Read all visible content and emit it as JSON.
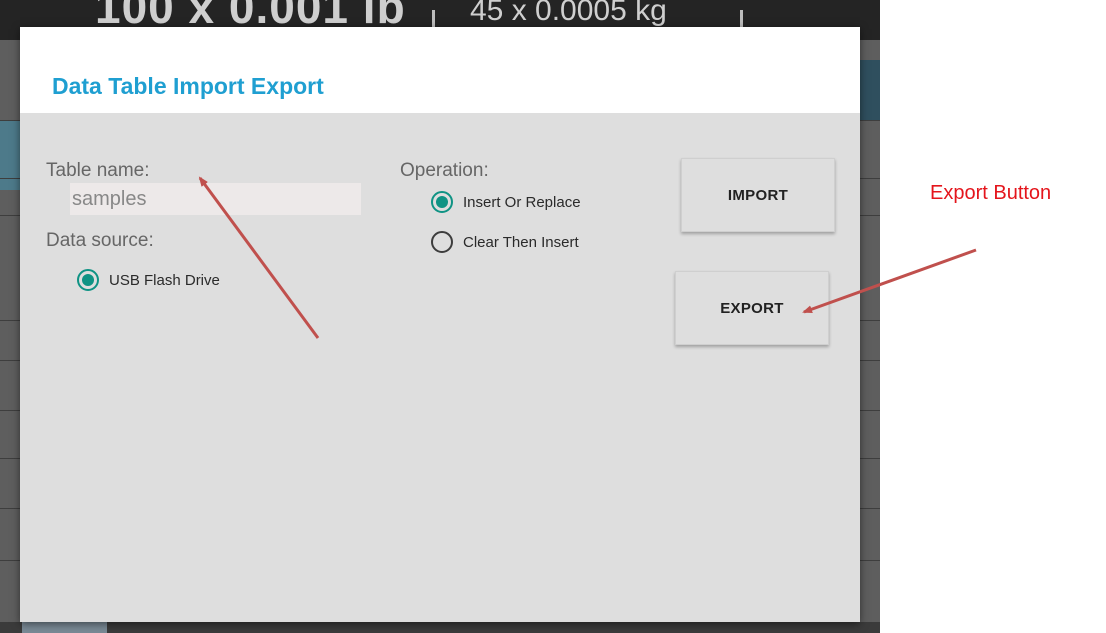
{
  "background": {
    "left_value": "100 x 0.001 lb",
    "right_value": "45 x 0.0005 kg"
  },
  "dialog": {
    "title": "Data Table Import Export",
    "table_name_label": "Table name:",
    "table_name_value": "samples",
    "data_source_label": "Data source:",
    "data_sources": [
      {
        "label": "USB Flash Drive",
        "checked": true
      }
    ],
    "operation_label": "Operation:",
    "operations": [
      {
        "label": "Insert Or Replace",
        "checked": true
      },
      {
        "label": "Clear Then Insert",
        "checked": false
      }
    ],
    "import_button": "IMPORT",
    "export_button": "EXPORT"
  },
  "annotation": {
    "text": "Export Button",
    "color": "#e4151c",
    "arrow_color": "#c0504d"
  },
  "colors": {
    "title": "#1f9fd1",
    "radio_accent": "#0f9384",
    "dialog_bg": "#dedede"
  }
}
